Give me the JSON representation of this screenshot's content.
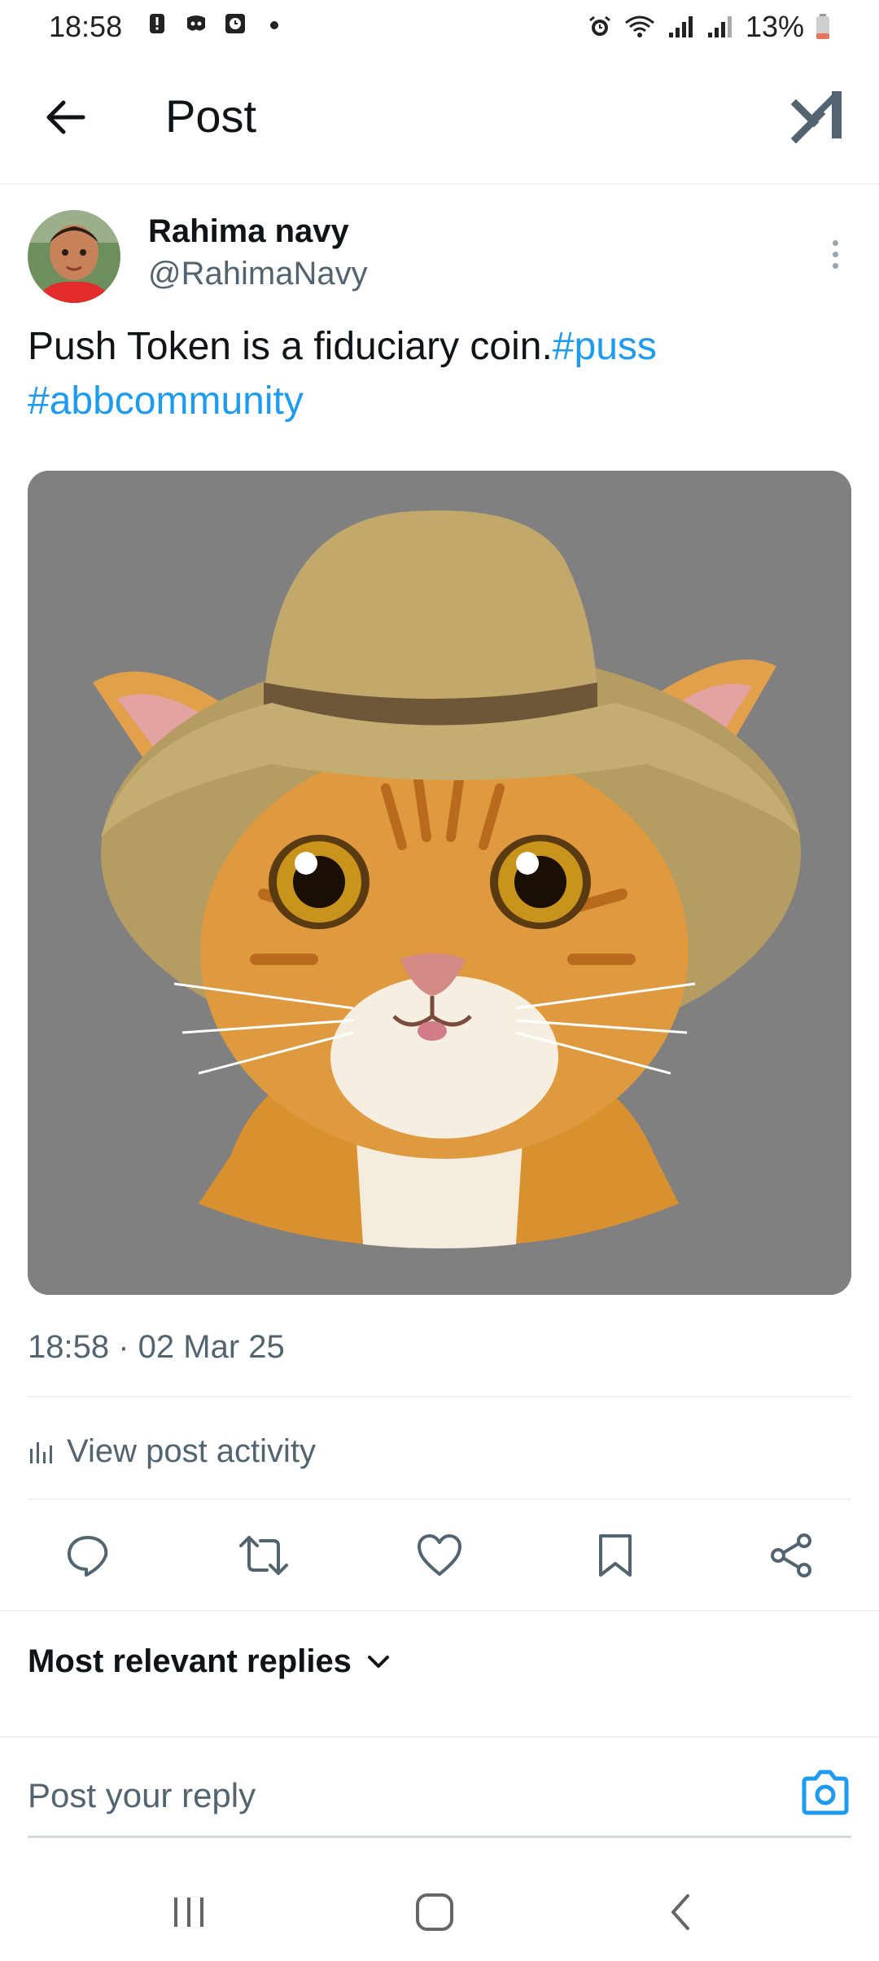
{
  "status_bar": {
    "time": "18:58",
    "battery": "13%",
    "left_icons": [
      "alert-icon",
      "discord-icon",
      "clock-app-icon",
      "dot-icon"
    ],
    "right_icons": [
      "alarm-icon",
      "wifi-icon",
      "signal-icon",
      "signal-icon",
      "battery-icon"
    ]
  },
  "header": {
    "title": "Post"
  },
  "post": {
    "author_name": "Rahima navy",
    "author_handle": "@RahimaNavy",
    "text": "Push Token is a fiduciary coin.",
    "hashtags": [
      "#puss",
      "#abbcommunity"
    ],
    "timestamp": "18:58 · 02 Mar 25",
    "activity_label": "View post activity",
    "media_description_icon": "cat-with-hat-image"
  },
  "actions": [
    "reply-icon",
    "repost-icon",
    "like-icon",
    "bookmark-icon",
    "share-icon"
  ],
  "replies": {
    "sort_label": "Most relevant replies"
  },
  "reply_box": {
    "placeholder": "Post your reply"
  },
  "colors": {
    "accent": "#1d9bf0",
    "text": "#0f1419",
    "secondary": "#536471",
    "media_bg": "#808080"
  }
}
